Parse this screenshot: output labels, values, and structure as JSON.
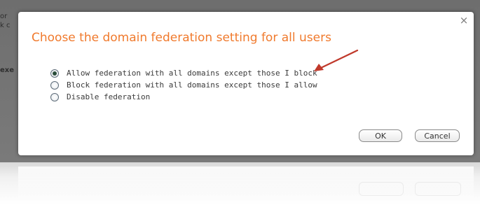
{
  "background": {
    "fragments": [
      "or",
      "k c",
      "exe"
    ]
  },
  "dialog": {
    "close_label": "×",
    "title": "Choose the domain federation setting for all users",
    "title_color": "#f07a2d",
    "options": [
      {
        "label": "Allow federation with all domains except those I block",
        "selected": true
      },
      {
        "label": "Block federation with all domains except those I allow",
        "selected": false
      },
      {
        "label": "Disable federation",
        "selected": false
      }
    ],
    "annotation_arrow_color": "#c0392b",
    "ok_label": "OK",
    "cancel_label": "Cancel"
  }
}
